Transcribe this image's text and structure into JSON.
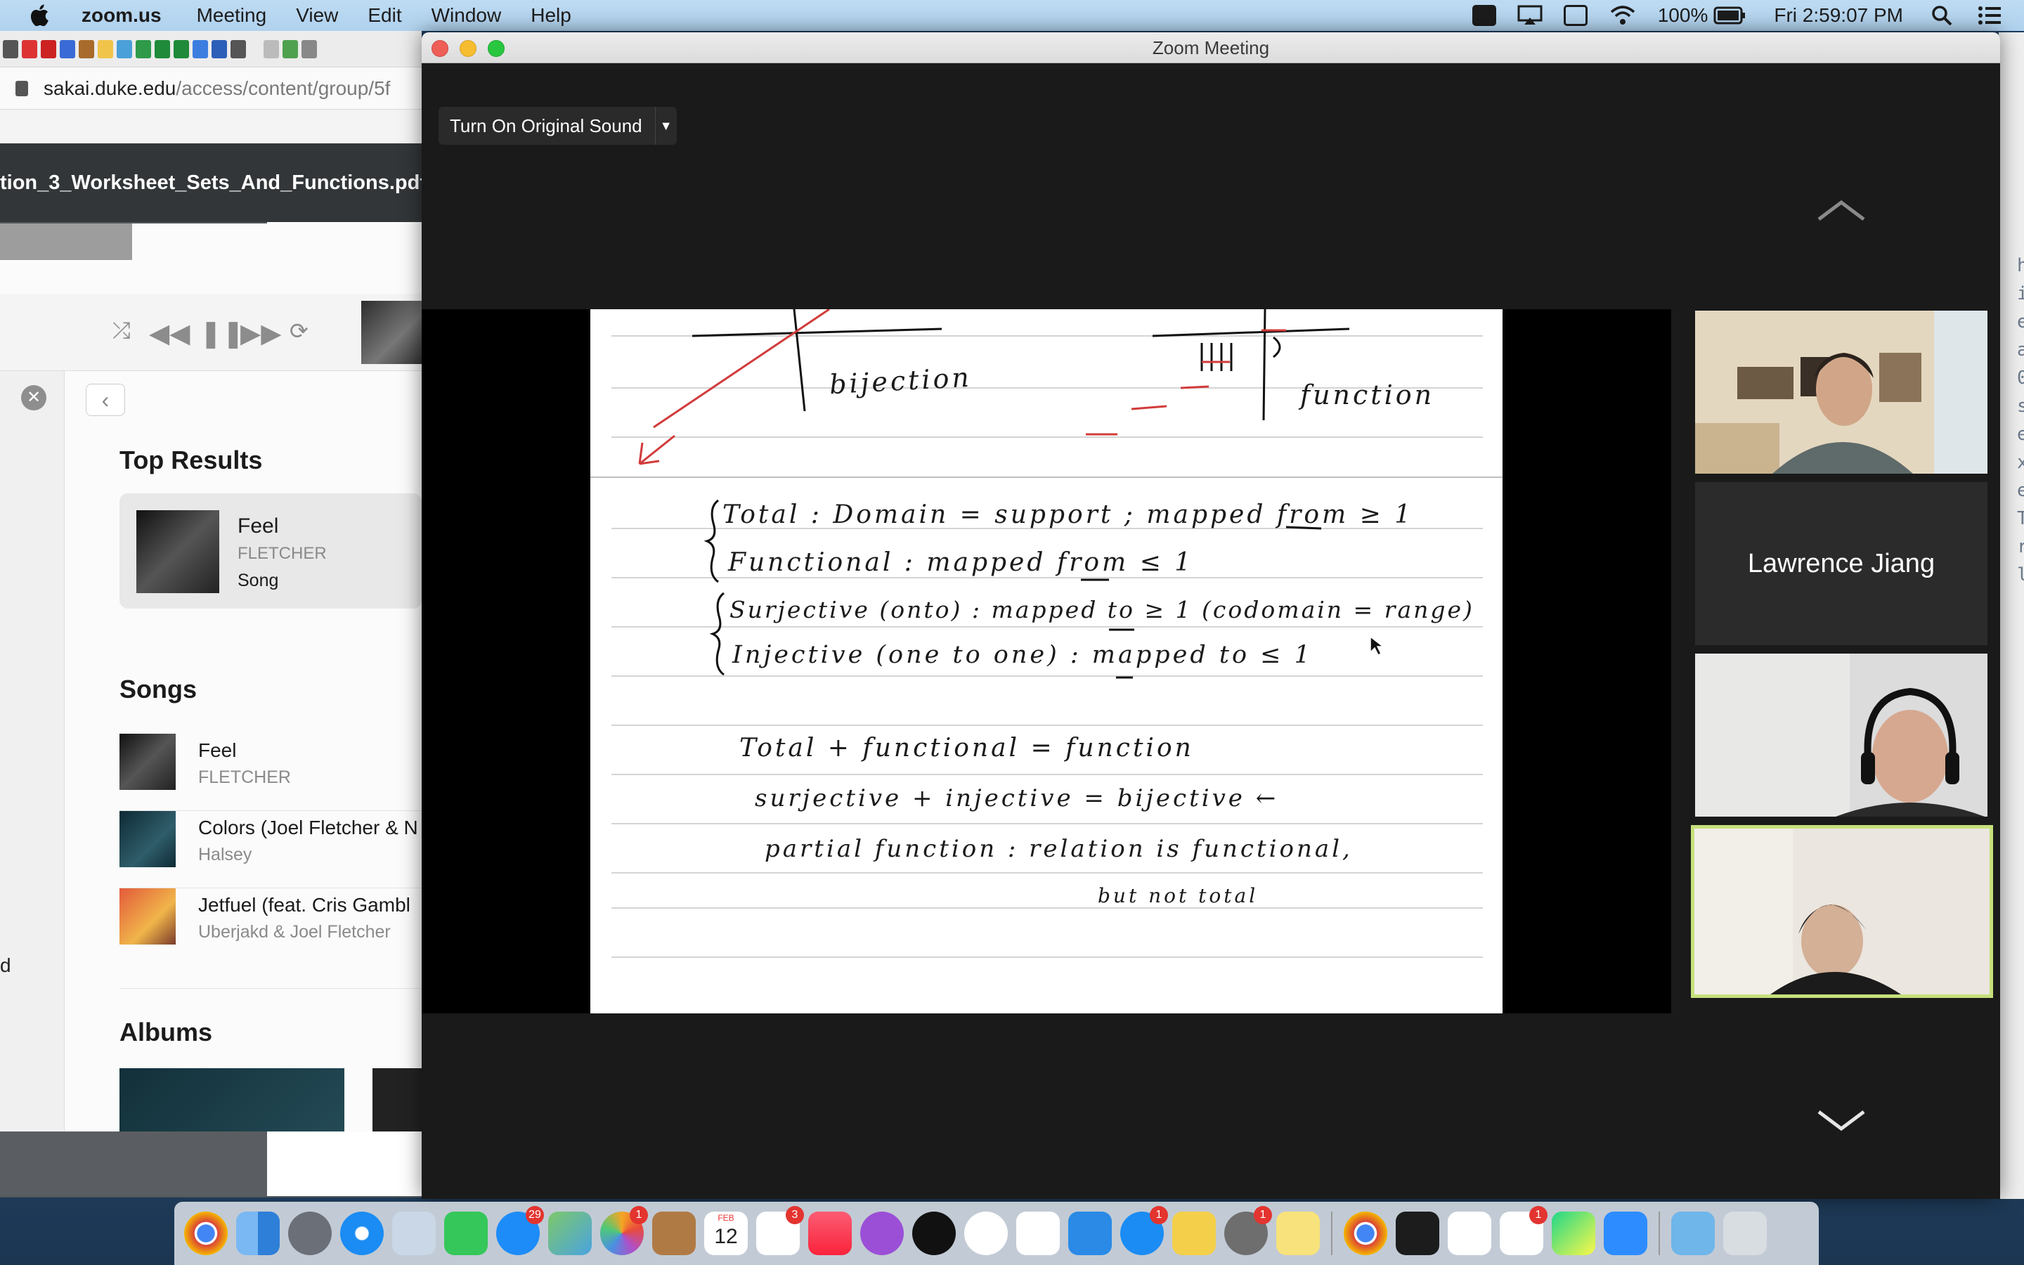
{
  "menubar": {
    "app_name": "zoom.us",
    "menus": [
      "Meeting",
      "View",
      "Edit",
      "Window",
      "Help"
    ],
    "battery": "100%",
    "clock": "Fri 2:59:07 PM"
  },
  "browser": {
    "url_host": "sakai.duke.edu",
    "url_path": "/access/content/group/5f",
    "pdf_title": "tion_3_Worksheet_Sets_And_Functions.pdf"
  },
  "music": {
    "top_results_heading": "Top Results",
    "top_result": {
      "title": "Feel",
      "artist": "FLETCHER",
      "kind": "Song"
    },
    "songs_heading": "Songs",
    "songs": [
      {
        "title": "Feel",
        "artist": "FLETCHER"
      },
      {
        "title": "Colors (Joel Fletcher & N",
        "artist": "Halsey"
      },
      {
        "title": "Jetfuel (feat. Cris Gambl",
        "artist": "Uberjakd & Joel Fletcher"
      }
    ],
    "albums_heading": "Albums",
    "stray_text": "d"
  },
  "zoom": {
    "window_title": "Zoom Meeting",
    "original_sound_label": "Turn On Original Sound",
    "participant_name": "Lawrence Jiang"
  },
  "whiteboard": {
    "lines": [
      "bijection",
      "function",
      "Total : Domain = support ; mapped from ≥ 1",
      "Functional : mapped from ≤ 1",
      "Surjective (onto) : mapped to ≥ 1  (codomain = range)",
      "Injective (one to one) : mapped to ≤ 1",
      "Total + functional = function",
      "surjective + injective = bijective ←",
      "partial function : relation is functional,",
      "but not total"
    ]
  },
  "dock": {
    "badges": {
      "messages": "29",
      "photos": "1",
      "calendar_day": "12",
      "calendar_month": "FEB",
      "reminders": "3",
      "appstore": "1",
      "prefs": "1",
      "slack": "1"
    }
  },
  "desktop_strip": [
    "h",
    "i",
    "e",
    "a",
    "0",
    "s",
    "e",
    "x",
    "e",
    "T",
    "r",
    "l"
  ]
}
